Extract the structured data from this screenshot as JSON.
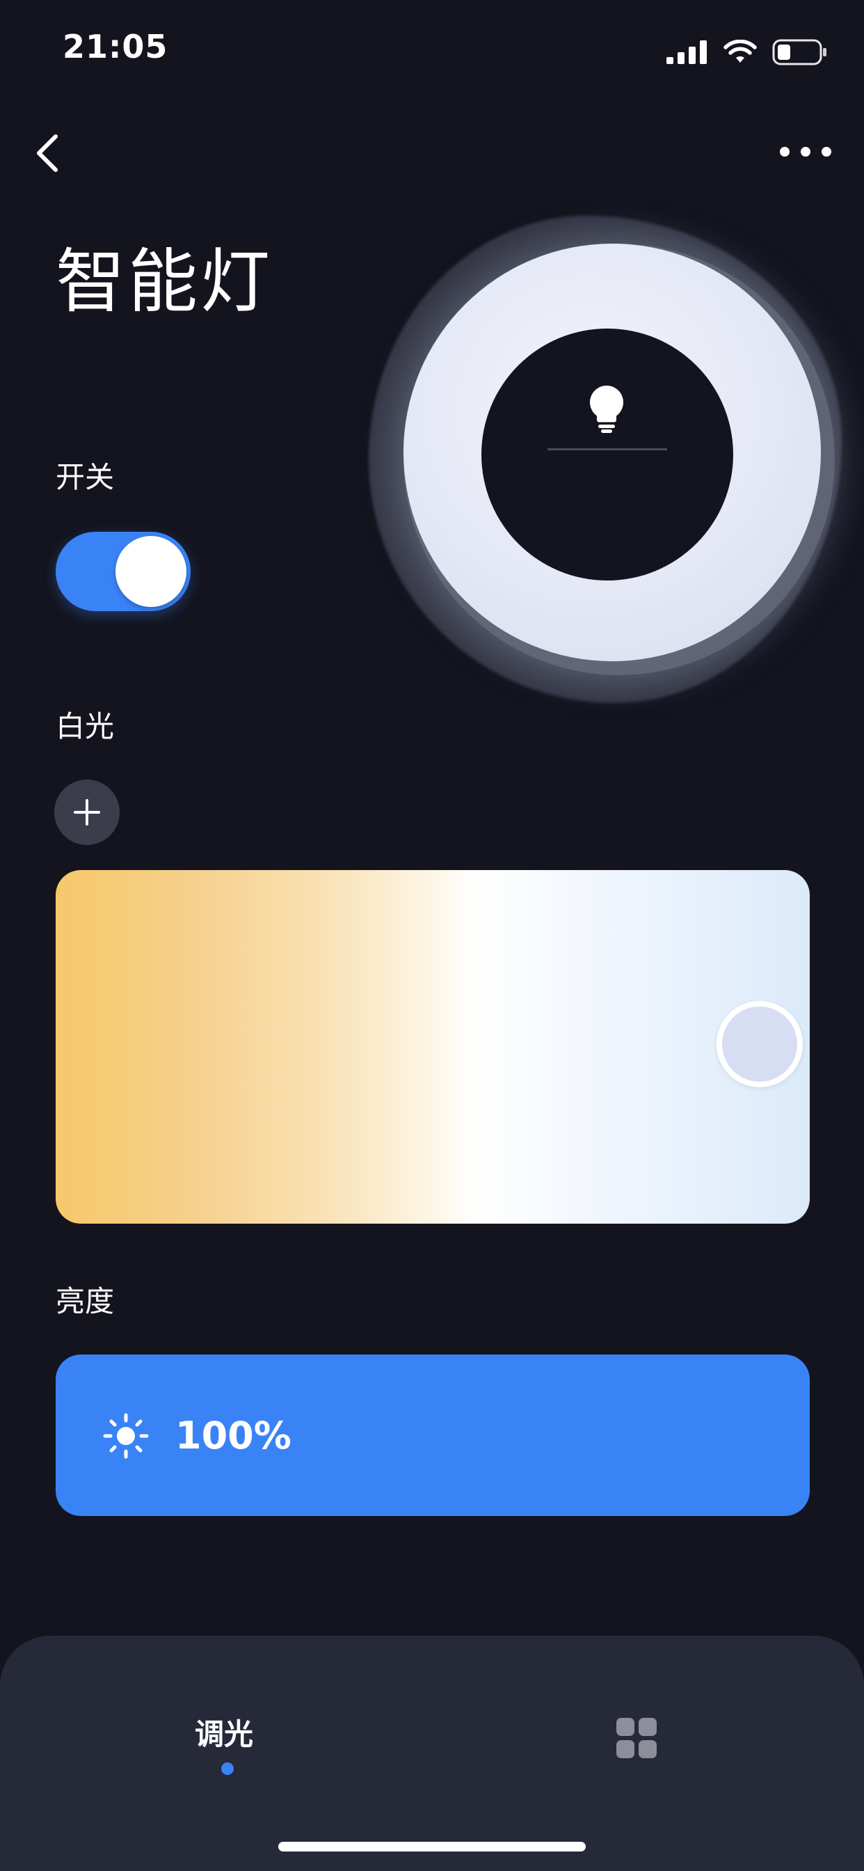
{
  "status_bar": {
    "time": "21:05",
    "icons": [
      "signal-icon",
      "wifi-icon",
      "battery-icon"
    ],
    "battery_level": 0.3
  },
  "nav": {
    "back_icon": "chevron-left-icon",
    "more_icon": "more-dots-icon"
  },
  "page": {
    "title": "智能灯"
  },
  "power": {
    "label": "开关",
    "on": true
  },
  "white_light": {
    "label": "白光",
    "add_icon": "plus-icon",
    "gradient_colors": [
      "#f7c86a",
      "#ffffff",
      "#dbeaf9"
    ],
    "selected_position": 0.95
  },
  "brightness": {
    "label": "亮度",
    "icon": "sun-icon",
    "value": "100%"
  },
  "tabs": [
    {
      "label": "调光",
      "active": true
    },
    {
      "icon": "grid-icon",
      "active": false
    }
  ],
  "colors": {
    "background": "#14141f",
    "accent": "#3a83f7",
    "panel": "#262938"
  }
}
